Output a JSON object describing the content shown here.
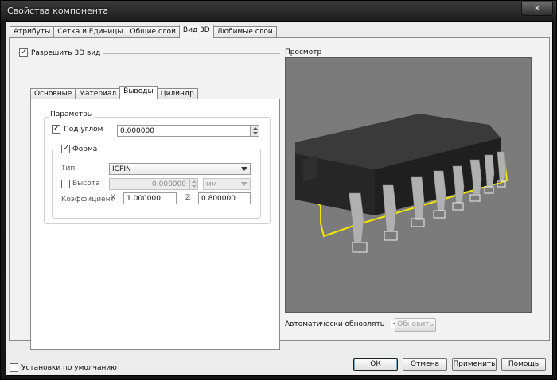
{
  "window": {
    "title": "Свойства компонента"
  },
  "tabs": [
    "Атрибуты",
    "Сетка и Единицы",
    "Общие слои",
    "Вид 3D",
    "Любимые слои"
  ],
  "enable3d": {
    "label": "Разрешить 3D вид",
    "checked": true
  },
  "subtabs": [
    "Основные",
    "Материал",
    "Выводы",
    "Цилиндр"
  ],
  "params": {
    "title": "Параметры",
    "angle": {
      "label": "Под углом",
      "value": "0.000000",
      "checked": true
    },
    "form": {
      "label": "Форма",
      "checked": true,
      "type_label": "Тип",
      "type_value": "ICPIN",
      "height_label": "Высота",
      "height_value": "0.000000",
      "height_unit": "мм",
      "coef_label": "Коэффициент",
      "x_label": "X",
      "x_value": "1.000000",
      "z_label": "Z",
      "z_value": "0.800000"
    }
  },
  "preview": {
    "label": "Просмотр",
    "auto_update_label": "Автоматически обновлять",
    "update_button": "Обновить"
  },
  "footer": {
    "defaults_label": "Установки по умолчанию",
    "ok": "ОК",
    "cancel": "Отмена",
    "apply": "Применить",
    "help": "Помощь"
  },
  "colors": {
    "chip_body": "#2c2c2c",
    "pins": "#a9a9a9",
    "outline": "#f2e600",
    "viewport_bg": "#7b7b7b"
  }
}
